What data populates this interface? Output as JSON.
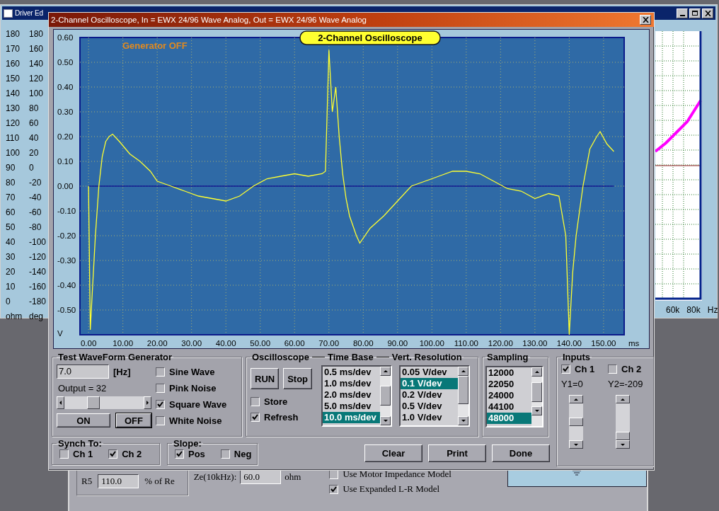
{
  "background_window": {
    "title": "Driver Ed",
    "ohm_labels": [
      "180",
      "170",
      "160",
      "150",
      "140",
      "130",
      "120",
      "110",
      "100",
      "90",
      "80",
      "70",
      "60",
      "50",
      "40",
      "30",
      "20",
      "10",
      "0"
    ],
    "deg_labels": [
      "180",
      "160",
      "140",
      "120",
      "100",
      "80",
      "60",
      "40",
      "20",
      "0",
      "-20",
      "-40",
      "-60",
      "-80",
      "-100",
      "-120",
      "-140",
      "-160",
      "-180"
    ],
    "y_units": [
      "ohm",
      "deg"
    ],
    "x_labels": [
      "60k",
      "80k"
    ],
    "x_unit": "Hz"
  },
  "bottom_window": {
    "fields": [
      {
        "label": "R5",
        "value": "110.0",
        "unit": "% of Re"
      },
      {
        "label": "Ze(10kHz):",
        "value": "60.0",
        "unit": "ohm"
      }
    ],
    "checkboxes": [
      {
        "label": "Use Motor Impedance Model",
        "checked": false
      },
      {
        "label": "Use Expanded L-R Model",
        "checked": true
      }
    ]
  },
  "window": {
    "title": "2-Channel Oscilloscope, In = EWX 24/96 Wave Analog, Out = EWX 24/96 Wave Analog"
  },
  "scope": {
    "generator_status": "Generator OFF",
    "chart_data": {
      "type": "line",
      "grid": true,
      "title": "2-Channel Oscilloscope",
      "xlabel": "ms",
      "ylabel": "V",
      "xlim": [
        -2.5,
        156
      ],
      "ylim": [
        -0.6,
        0.6
      ],
      "x": [
        0,
        0.5,
        1,
        2,
        3,
        4,
        5,
        6,
        7,
        9,
        12,
        15,
        18,
        20,
        24,
        28,
        32,
        36,
        40,
        44,
        48,
        52,
        56,
        60,
        64,
        68,
        69,
        70,
        71,
        72,
        73,
        74,
        75,
        76,
        78,
        79,
        82,
        86,
        90,
        94,
        98,
        102,
        106,
        110,
        114,
        118,
        122,
        126,
        130,
        134,
        137,
        139,
        140,
        141,
        142,
        144,
        146,
        148,
        149,
        151,
        153
      ],
      "series": [
        {
          "color": "#101890",
          "values": [
            0,
            0,
            0,
            0,
            0,
            0,
            0,
            0,
            0,
            0,
            0,
            0,
            0,
            0,
            0,
            0,
            0,
            0,
            0,
            0,
            0,
            0,
            0,
            0,
            0,
            0,
            0,
            0,
            0,
            0,
            0,
            0,
            0,
            0,
            0,
            0,
            0,
            0,
            0,
            0,
            0,
            0,
            0,
            0,
            0,
            0,
            0,
            0,
            0,
            0,
            0,
            0,
            0,
            0,
            0,
            0,
            0,
            0,
            0,
            0,
            0
          ]
        },
        {
          "color": "#ffff30",
          "values": [
            0,
            -0.58,
            -0.45,
            -0.2,
            0,
            0.12,
            0.18,
            0.2,
            0.21,
            0.18,
            0.13,
            0.1,
            0.06,
            0.02,
            0,
            -0.02,
            -0.04,
            -0.05,
            -0.06,
            -0.04,
            0,
            0.03,
            0.04,
            0.05,
            0.04,
            0.05,
            0.06,
            0.55,
            0.3,
            0.4,
            0.2,
            0.05,
            -0.05,
            -0.12,
            -0.2,
            -0.23,
            -0.17,
            -0.12,
            -0.06,
            0,
            0.02,
            0.04,
            0.06,
            0.06,
            0.05,
            0.02,
            -0.01,
            -0.02,
            -0.05,
            -0.03,
            -0.04,
            -0.2,
            -0.6,
            -0.35,
            -0.2,
            0,
            0.15,
            0.2,
            0.22,
            0.17,
            0.14
          ]
        }
      ],
      "xticks": [
        {
          "value": 0,
          "label": "0.00"
        },
        {
          "value": 10,
          "label": "10.00"
        },
        {
          "value": 20,
          "label": "20.00"
        },
        {
          "value": 30,
          "label": "30.00"
        },
        {
          "value": 40,
          "label": "40.00"
        },
        {
          "value": 50,
          "label": "50.00"
        },
        {
          "value": 60,
          "label": "60.00"
        },
        {
          "value": 70,
          "label": "70.00"
        },
        {
          "value": 80,
          "label": "80.00"
        },
        {
          "value": 90,
          "label": "90.00"
        },
        {
          "value": 100,
          "label": "100.00"
        },
        {
          "value": 110,
          "label": "110.00"
        },
        {
          "value": 120,
          "label": "120.00"
        },
        {
          "value": 130,
          "label": "130.00"
        },
        {
          "value": 140,
          "label": "140.00"
        },
        {
          "value": 150,
          "label": "150.00"
        }
      ],
      "yticks": [
        {
          "value": 0.6,
          "label": "0.60"
        },
        {
          "value": 0.5,
          "label": "0.50"
        },
        {
          "value": 0.4,
          "label": "0.40"
        },
        {
          "value": 0.3,
          "label": "0.30"
        },
        {
          "value": 0.2,
          "label": "0.20"
        },
        {
          "value": 0.1,
          "label": "0.10"
        },
        {
          "value": 0,
          "label": "0.00"
        },
        {
          "value": -0.1,
          "label": "-0.10"
        },
        {
          "value": -0.2,
          "label": "-0.20"
        },
        {
          "value": -0.3,
          "label": "-0.30"
        },
        {
          "value": -0.4,
          "label": "-0.40"
        },
        {
          "value": -0.5,
          "label": "-0.50"
        }
      ]
    }
  },
  "generator": {
    "title": "Test WaveForm Generator",
    "frequency": "7.0",
    "frequency_unit": "[Hz]",
    "output": "Output = 32",
    "level": 0.33,
    "buttons": [
      {
        "label": "ON",
        "selected": false
      },
      {
        "label": "OFF",
        "selected": true
      }
    ],
    "waveforms": [
      {
        "label": "Sine Wave",
        "checked": false
      },
      {
        "label": "Pink Noise",
        "checked": false
      },
      {
        "label": "Square Wave",
        "checked": true
      },
      {
        "label": "White Noise",
        "checked": false
      }
    ]
  },
  "oscilloscope": {
    "titles": [
      "Oscilloscope",
      "Time Base",
      "Vert. Resolution"
    ],
    "buttons": [
      "RUN",
      "Stop"
    ],
    "options": [
      {
        "label": "Store",
        "checked": false
      },
      {
        "label": "Refresh",
        "checked": true
      }
    ],
    "time_base": [
      {
        "label": "0.5 ms/dev",
        "selected": false
      },
      {
        "label": "1.0 ms/dev",
        "selected": false
      },
      {
        "label": "2.0 ms/dev",
        "selected": false
      },
      {
        "label": "5.0 ms/dev",
        "selected": false
      },
      {
        "label": "10.0 ms/dev",
        "selected": true
      }
    ],
    "vert_resolution": [
      {
        "label": "0.05 V/dev",
        "selected": false
      },
      {
        "label": "0.1 V/dev",
        "selected": true
      },
      {
        "label": "0.2 V/dev",
        "selected": false
      },
      {
        "label": "0.5 V/dev",
        "selected": false
      },
      {
        "label": "1.0 V/dev",
        "selected": false
      }
    ]
  },
  "sampling": {
    "title": "Sampling",
    "rates": [
      {
        "label": "12000",
        "selected": false
      },
      {
        "label": "22050",
        "selected": false
      },
      {
        "label": "24000",
        "selected": false
      },
      {
        "label": "44100",
        "selected": false
      },
      {
        "label": "48000",
        "selected": true
      }
    ]
  },
  "inputs": {
    "title": "Inputs",
    "channels": [
      {
        "label": "Ch 1",
        "checked": true,
        "offset": "Y1=0"
      },
      {
        "label": "Ch 2",
        "checked": false,
        "offset": "Y2=-209"
      }
    ]
  },
  "synch": {
    "title": "Synch To:",
    "options": [
      {
        "label": "Ch 1",
        "checked": false
      },
      {
        "label": "Ch 2",
        "checked": true
      }
    ]
  },
  "slope": {
    "title": "Slope:",
    "options": [
      {
        "label": "Pos",
        "checked": true
      },
      {
        "label": "Neg",
        "checked": false
      }
    ]
  },
  "actions": [
    "Clear",
    "Print",
    "Done"
  ]
}
